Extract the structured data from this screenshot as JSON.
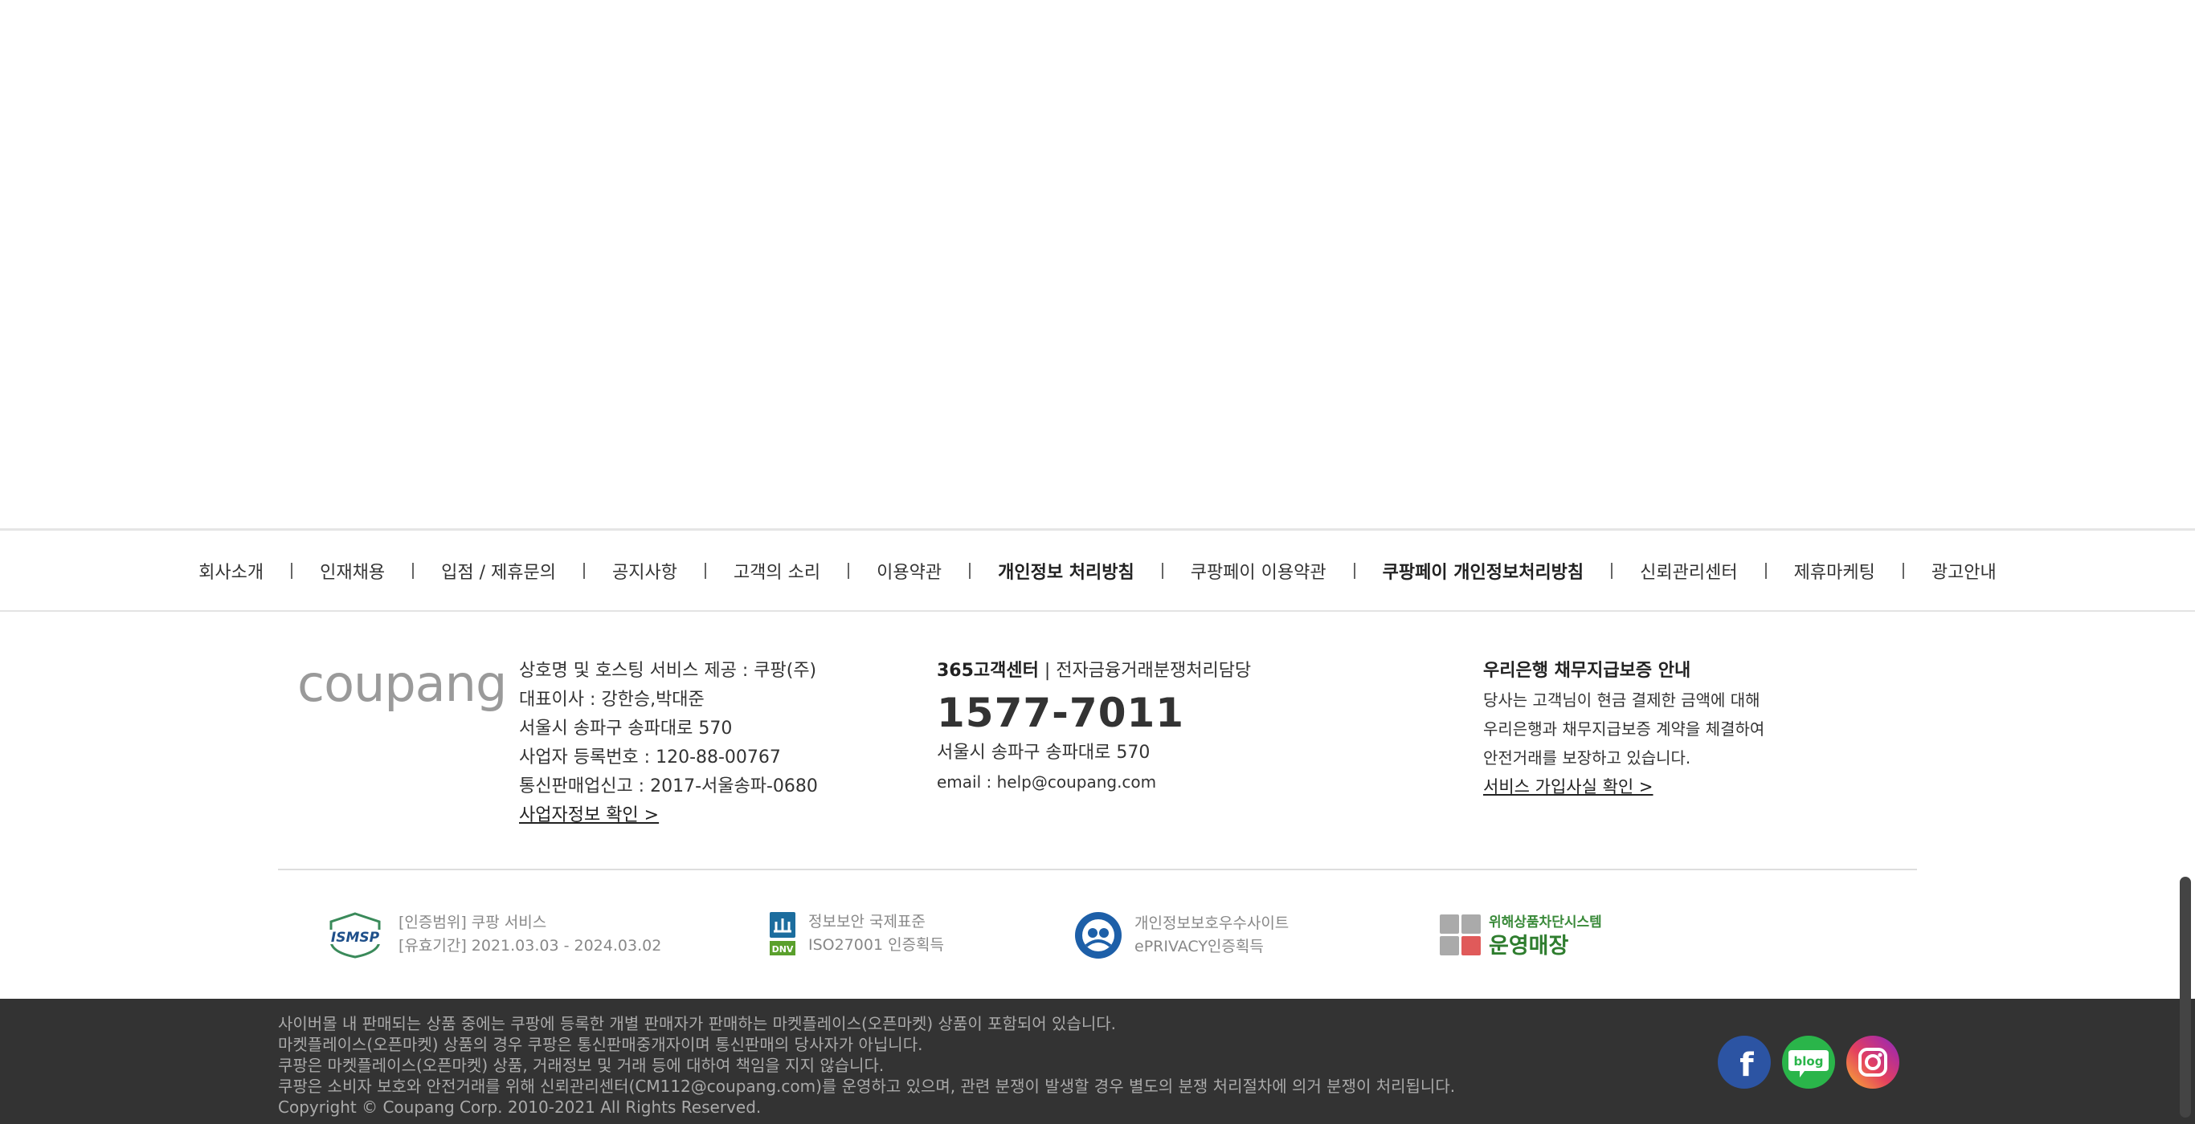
{
  "nav": {
    "items": [
      {
        "label": "회사소개",
        "bold": false
      },
      {
        "label": "인재채용",
        "bold": false
      },
      {
        "label": "입점 / 제휴문의",
        "bold": false
      },
      {
        "label": "공지사항",
        "bold": false
      },
      {
        "label": "고객의 소리",
        "bold": false
      },
      {
        "label": "이용약관",
        "bold": false
      },
      {
        "label": "개인정보 처리방침",
        "bold": true
      },
      {
        "label": "쿠팡페이 이용약관",
        "bold": false
      },
      {
        "label": "쿠팡페이 개인정보처리방침",
        "bold": true
      },
      {
        "label": "신뢰관리센터",
        "bold": false
      },
      {
        "label": "제휴마케팅",
        "bold": false
      },
      {
        "label": "광고안내",
        "bold": false
      }
    ]
  },
  "logo": "coupang",
  "company": {
    "line1": "상호명 및 호스팅 서비스 제공 : 쿠팡(주)",
    "line2": "대표이사 : 강한승,박대준",
    "line3": "서울시 송파구 송파대로 570",
    "line4": "사업자 등록번호 : 120-88-00767",
    "line5": "통신판매업신고 : 2017-서울송파-0680",
    "link": "사업자정보 확인 >"
  },
  "cs": {
    "title_bold": "365고객센터",
    "title_rest": " | 전자금융거래분쟁처리담당",
    "phone": "1577-7011",
    "address": "서울시 송파구 송파대로 570",
    "email": "email : help@coupang.com"
  },
  "bank": {
    "title": "우리은행 채무지급보증 안내",
    "line1": "당사는 고객님이 현금 결제한 금액에 대해",
    "line2": "우리은행과 채무지급보증 계약을 체결하여",
    "line3": "안전거래를 보장하고 있습니다.",
    "link": "서비스 가입사실 확인 >"
  },
  "certs": {
    "isms": {
      "logo": "ISMSP",
      "line1": "[인증범위] 쿠팡 서비스",
      "line2": "[유효기간] 2021.03.03 - 2024.03.02"
    },
    "iso": {
      "logo": "DNV",
      "line1": "정보보안 국제표준",
      "line2": "ISO27001 인증획득"
    },
    "eprivacy": {
      "line1": "개인정보보호우수사이트",
      "line2": "ePRIVACY인증획득"
    },
    "store": {
      "line1": "위해상품차단시스템",
      "line2": "운영매장"
    }
  },
  "notices": {
    "line1": "사이버몰 내 판매되는 상품 중에는 쿠팡에 등록한 개별 판매자가 판매하는 마켓플레이스(오픈마켓) 상품이 포함되어 있습니다.",
    "line2": "마켓플레이스(오픈마켓) 상품의 경우 쿠팡은 통신판매중개자이며 통신판매의 당사자가 아닙니다.",
    "line3": "쿠팡은 마켓플레이스(오픈마켓) 상품, 거래정보 및 거래 등에 대하여 책임을 지지 않습니다.",
    "line4": "쿠팡은 소비자 보호와 안전거래를 위해 신뢰관리센터(CM112@coupang.com)를 운영하고 있으며, 관련 분쟁이 발생할 경우 별도의 분쟁 처리절차에 의거 분쟁이 처리됩니다.",
    "copyright": "Copyright © Coupang Corp. 2010-2021 All Rights Reserved."
  },
  "social": {
    "facebook": "f",
    "blog": "blog",
    "instagram": "instagram-icon"
  },
  "colors": {
    "footer_bg": "#333333",
    "facebook": "#2c54a3",
    "blog": "#2ab54a"
  }
}
